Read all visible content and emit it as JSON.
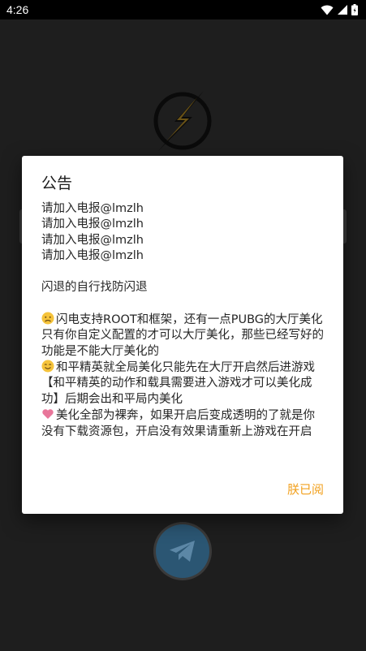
{
  "status_bar": {
    "time": "4:26",
    "icons": [
      "wifi-icon",
      "signal-icon",
      "battery-icon"
    ]
  },
  "background": {
    "logo": "lightning-logo-icon",
    "fab": "telegram-icon"
  },
  "dialog": {
    "title": "公告",
    "telegram_lines": [
      "请加入电报@lmzlh",
      "请加入电报@lmzlh",
      "请加入电报@lmzlh",
      "请加入电报@lmzlh"
    ],
    "crash_note": "闪退的自行找防闪退",
    "para1": "闪电支持ROOT和框架，还有一点PUBG的大厅美化只有你自定义配置的才可以大厅美化，那些已经写好的功能是不能大厅美化的",
    "para1_icon": "frowning-face-emoji",
    "para2": "和平精英就全局美化只能先在大厅开启然后进游戏",
    "para2_icon": "hugging-face-emoji",
    "para3": "【和平精英的动作和载具需要进入游戏才可以美化成功】后期会出和平局内美化",
    "para4": "美化全部为裸奔，如果开启后变成透明的了就是你没有下载资源包，开启没有效果请重新上游戏在开启",
    "para4_icon": "pink-heart-emoji",
    "confirm_label": "朕已阅"
  },
  "colors": {
    "accent": "#f2a11f",
    "background": "#1e1e1e",
    "dialog": "#ffffff"
  }
}
